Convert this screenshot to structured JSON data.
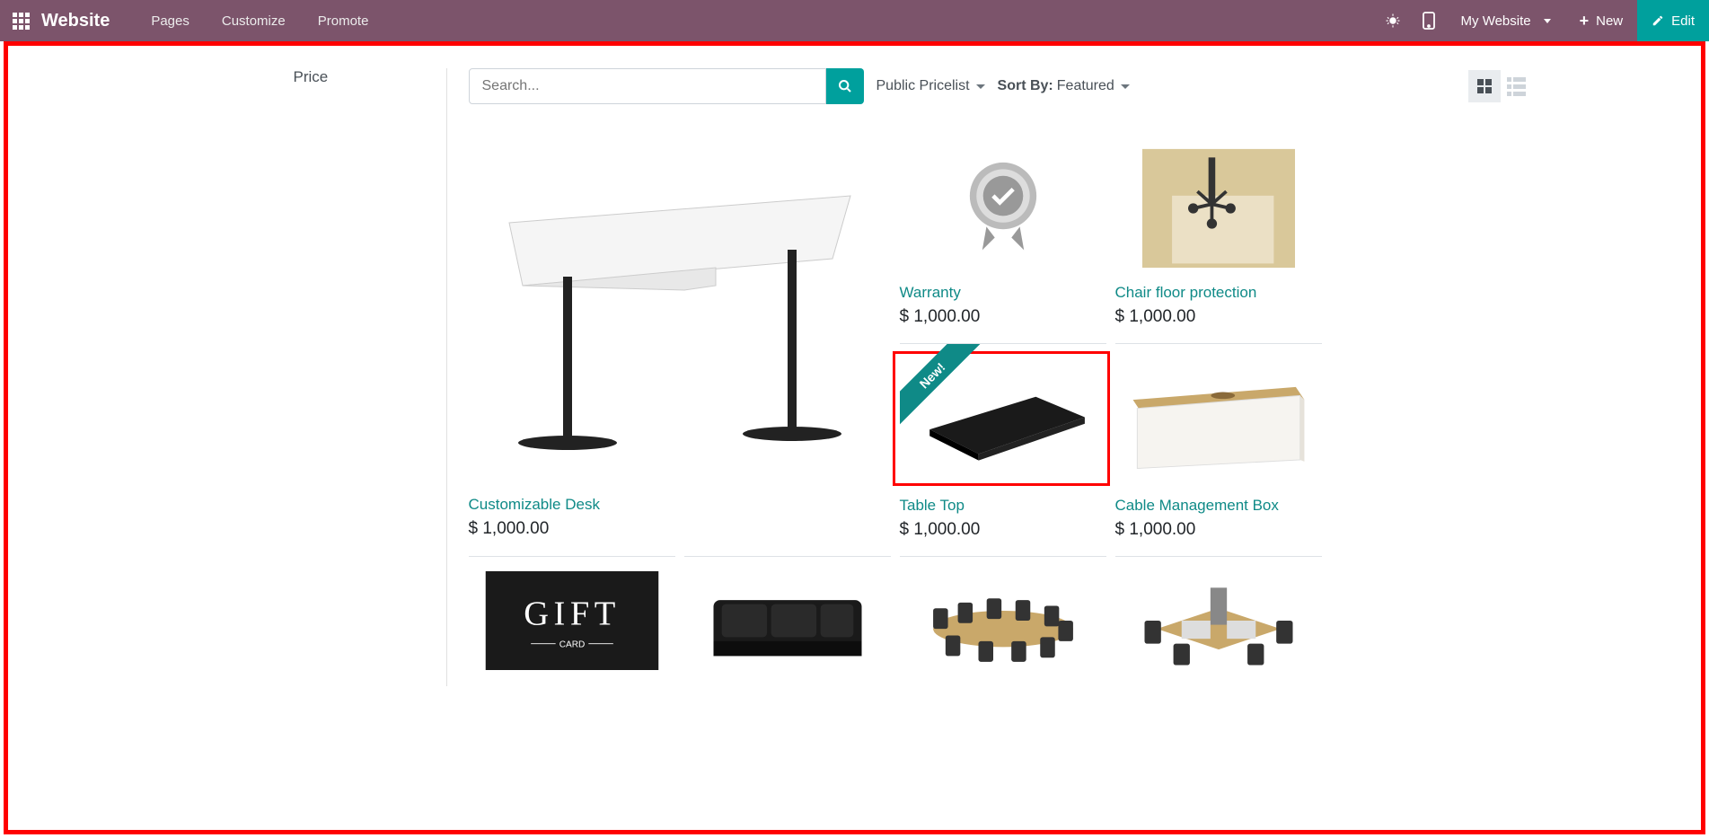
{
  "topbar": {
    "brand": "Website",
    "links": [
      "Pages",
      "Customize",
      "Promote"
    ],
    "website_selector": "My Website",
    "new_label": "New",
    "edit_label": "Edit"
  },
  "sidebar": {
    "price_heading": "Price"
  },
  "toolbar": {
    "search_placeholder": "Search...",
    "pricelist": "Public Pricelist",
    "sort_label": "Sort By:",
    "sort_value": "Featured"
  },
  "products": {
    "big": {
      "name": "Customizable Desk",
      "price": "$ 1,000.00"
    },
    "warranty": {
      "name": "Warranty",
      "price": "$ 1,000.00"
    },
    "chair_floor": {
      "name": "Chair floor protection",
      "price": "$ 1,000.00"
    },
    "table_top": {
      "name": "Table Top",
      "price": "$ 1,000.00",
      "ribbon": "New!"
    },
    "cable_box": {
      "name": "Cable Management Box",
      "price": "$ 1,000.00"
    }
  }
}
